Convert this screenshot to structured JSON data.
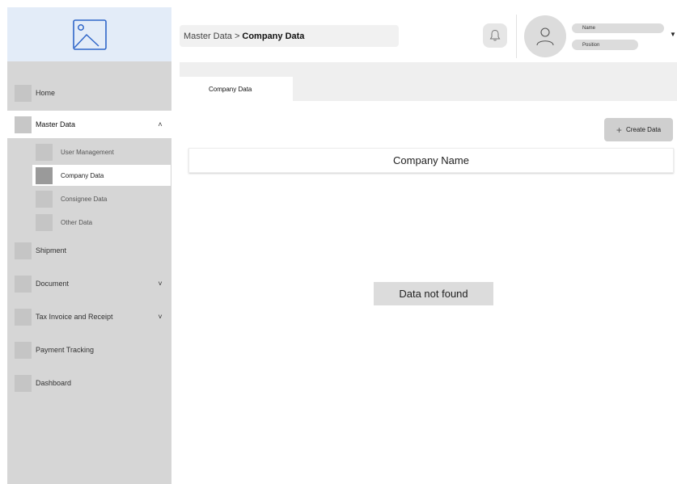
{
  "header": {
    "breadcrumb_parent": "Master Data >",
    "breadcrumb_current": "Company Data",
    "profile_name": "Name",
    "profile_position": "Position",
    "bell_icon": "bell-icon",
    "avatar_icon": "user-icon"
  },
  "sidebar": {
    "logo_icon": "image-placeholder-icon",
    "items": [
      {
        "label": "Home"
      },
      {
        "label": "Master Data",
        "expanded": true
      },
      {
        "label": "Shipment"
      },
      {
        "label": "Document"
      },
      {
        "label": "Tax Invoice and Receipt"
      },
      {
        "label": "Payment Tracking"
      },
      {
        "label": "Dashboard"
      }
    ],
    "master_sub": [
      {
        "label": "User Management"
      },
      {
        "label": "Company Data",
        "active": true
      },
      {
        "label": "Consignee Data"
      },
      {
        "label": "Other Data"
      }
    ],
    "chevrons": {
      "up": "˄",
      "down": "˅"
    }
  },
  "main": {
    "tab_label": "Company Data",
    "create_label": "Create Data",
    "create_icon": "+",
    "table_header": "Company Name",
    "empty_message": "Data not found"
  },
  "colors": {
    "sidebar_bg": "#d6d6d6",
    "logo_bg": "#e3ecf8",
    "logo_icon": "#2f66c9"
  }
}
